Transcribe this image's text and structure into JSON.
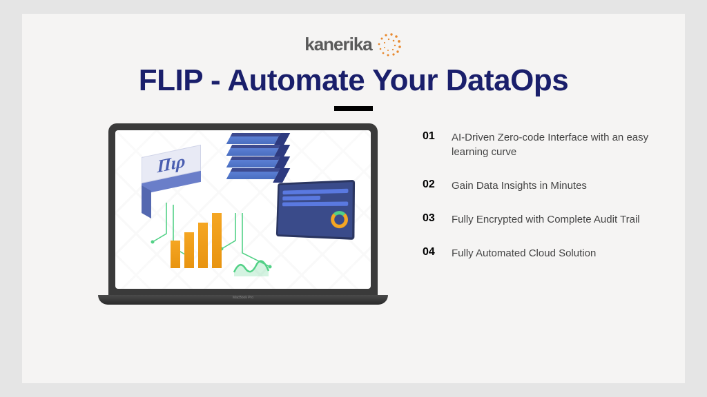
{
  "logo": {
    "name": "kanerika"
  },
  "title": "FLIP - Automate Your DataOps",
  "graphic": {
    "cube_label": "Πιρ",
    "laptop_label": "MacBook Pro"
  },
  "features": [
    {
      "num": "01",
      "text": "AI-Driven Zero-code Interface with an easy learning curve"
    },
    {
      "num": "02",
      "text": "Gain Data Insights in Minutes"
    },
    {
      "num": "03",
      "text": "Fully Encrypted with Complete Audit Trail"
    },
    {
      "num": "04",
      "text": "Fully Automated Cloud Solution"
    }
  ]
}
